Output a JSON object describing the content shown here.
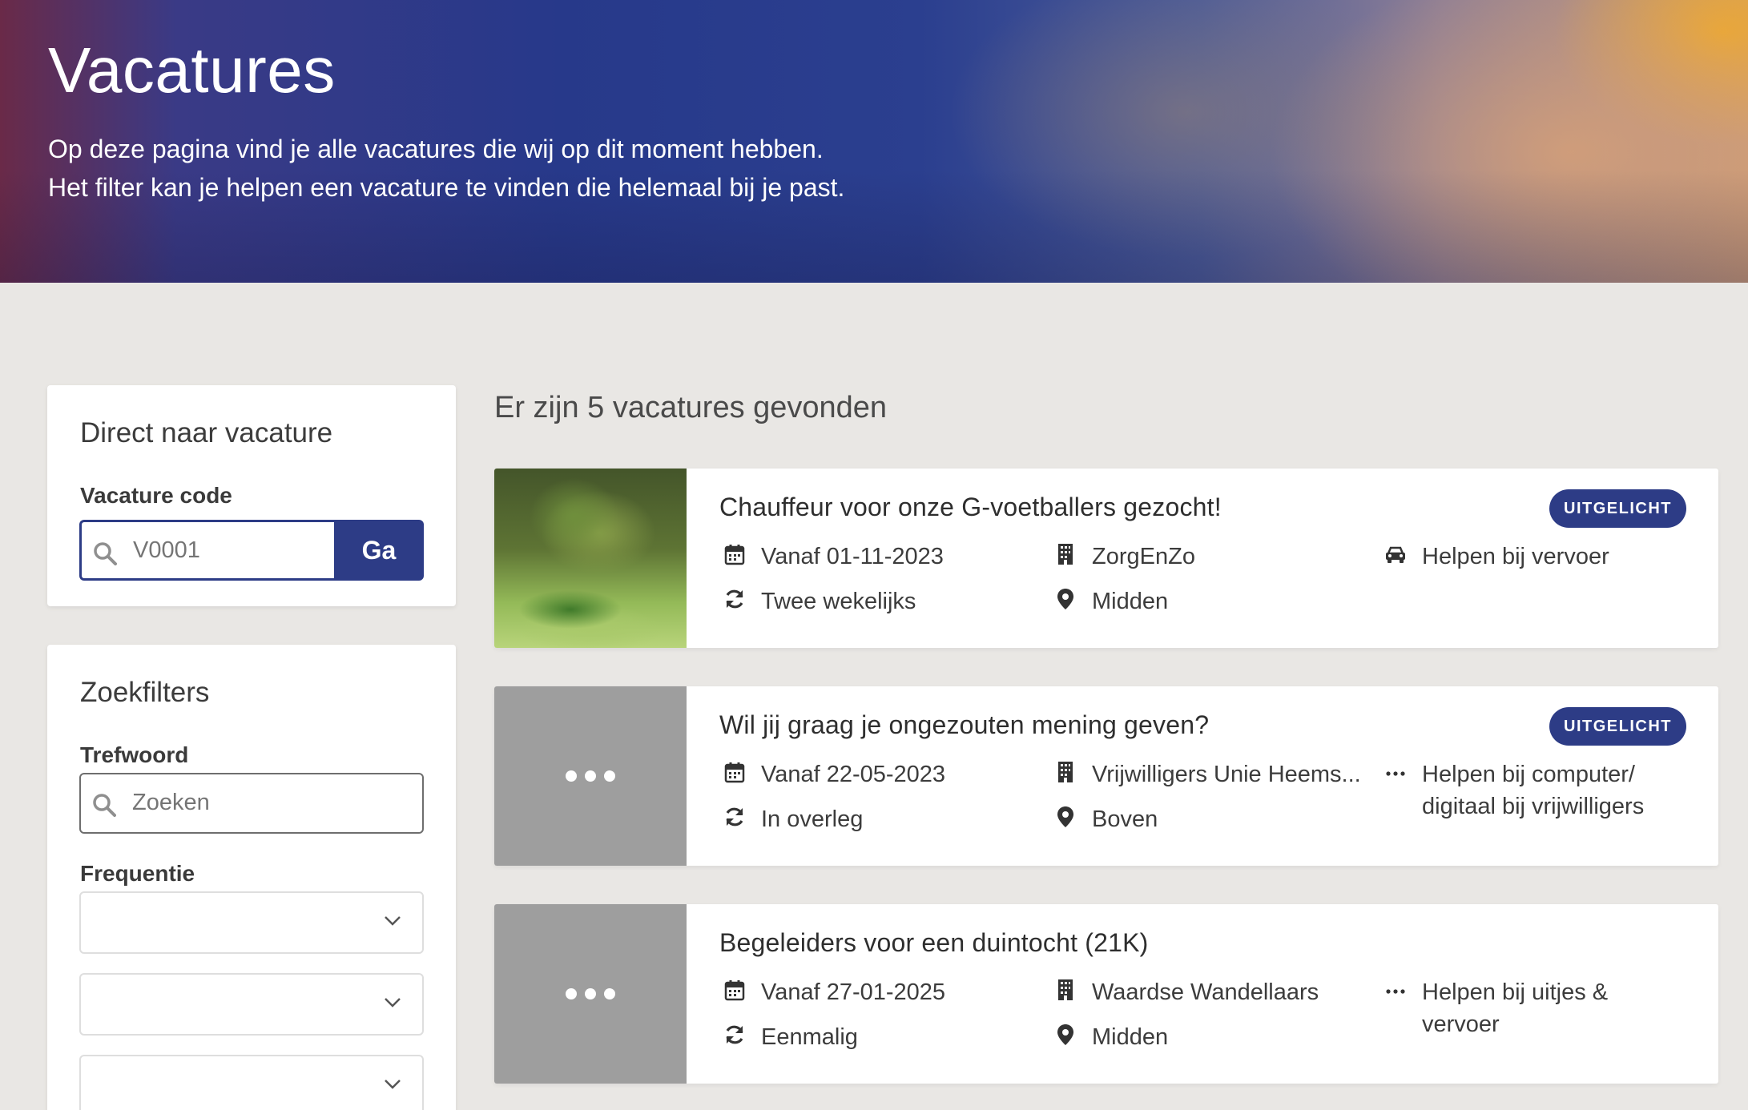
{
  "hero": {
    "title": "Vacatures",
    "line1": "Op deze pagina vind je alle vacatures die wij op dit moment hebben.",
    "line2": "Het filter kan je helpen een vacature te vinden die helemaal bij je past."
  },
  "direct": {
    "title": "Direct naar vacature",
    "code_label": "Vacature code",
    "code_placeholder": "V0001",
    "go_label": "Ga"
  },
  "filters": {
    "title": "Zoekfilters",
    "keyword_label": "Trefwoord",
    "keyword_placeholder": "Zoeken",
    "frequency_label": "Frequentie",
    "selects": [
      "",
      "",
      ""
    ]
  },
  "results": {
    "count_text": "Er zijn 5 vacatures gevonden",
    "items": [
      {
        "title": "Chauffeur voor onze G-voetballers gezocht!",
        "badge": "UITGELICHT",
        "date": "Vanaf 01-11-2023",
        "frequency": "Twee wekelijks",
        "organisation": "ZorgEnZo",
        "region": "Midden",
        "category": "Helpen bij vervoer",
        "category_icon": "car-icon",
        "thumb": "photo"
      },
      {
        "title": "Wil jij graag je ongezouten mening geven?",
        "badge": "UITGELICHT",
        "date": "Vanaf 22-05-2023",
        "frequency": "In overleg",
        "organisation": "Vrijwilligers Unie Heems...",
        "region": "Boven",
        "category": "Helpen bij computer/ digitaal bij vrijwilligers",
        "category_icon": "ellipsis-icon",
        "thumb": "placeholder"
      },
      {
        "title": "Begeleiders voor een duintocht (21K)",
        "badge": "",
        "date": "Vanaf 27-01-2025",
        "frequency": "Eenmalig",
        "organisation": "Waardse Wandellaars",
        "region": "Midden",
        "category": "Helpen bij uitjes & vervoer",
        "category_icon": "ellipsis-icon",
        "thumb": "placeholder"
      }
    ]
  },
  "colors": {
    "accent": "#2d3c86",
    "background": "#e9e7e4",
    "placeholder_thumb": "#9e9e9e"
  }
}
